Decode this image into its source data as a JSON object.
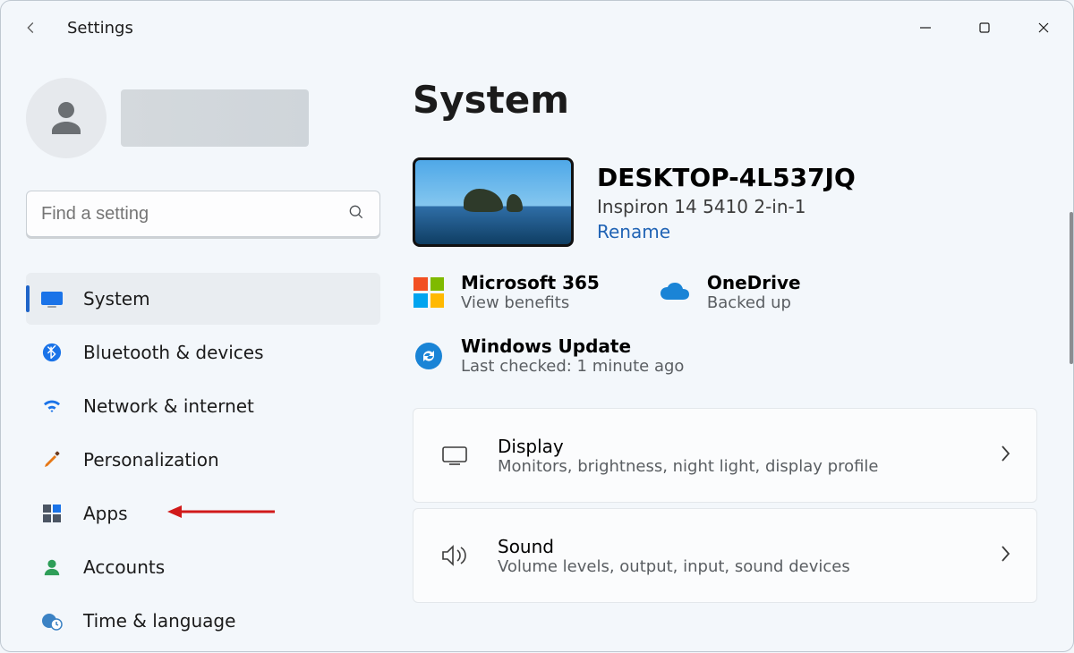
{
  "titlebar": {
    "app_title": "Settings"
  },
  "sidebar": {
    "search_placeholder": "Find a setting",
    "items": [
      {
        "label": "System"
      },
      {
        "label": "Bluetooth & devices"
      },
      {
        "label": "Network & internet"
      },
      {
        "label": "Personalization"
      },
      {
        "label": "Apps"
      },
      {
        "label": "Accounts"
      },
      {
        "label": "Time & language"
      }
    ]
  },
  "page": {
    "title": "System",
    "device": {
      "name": "DESKTOP-4L537JQ",
      "model": "Inspiron 14 5410 2-in-1",
      "rename_label": "Rename"
    },
    "tiles": {
      "ms365": {
        "title": "Microsoft 365",
        "subtitle": "View benefits"
      },
      "onedrive": {
        "title": "OneDrive",
        "subtitle": "Backed up"
      },
      "update": {
        "title": "Windows Update",
        "subtitle": "Last checked: 1 minute ago"
      }
    },
    "cards": [
      {
        "title": "Display",
        "subtitle": "Monitors, brightness, night light, display profile"
      },
      {
        "title": "Sound",
        "subtitle": "Volume levels, output, input, sound devices"
      }
    ]
  }
}
